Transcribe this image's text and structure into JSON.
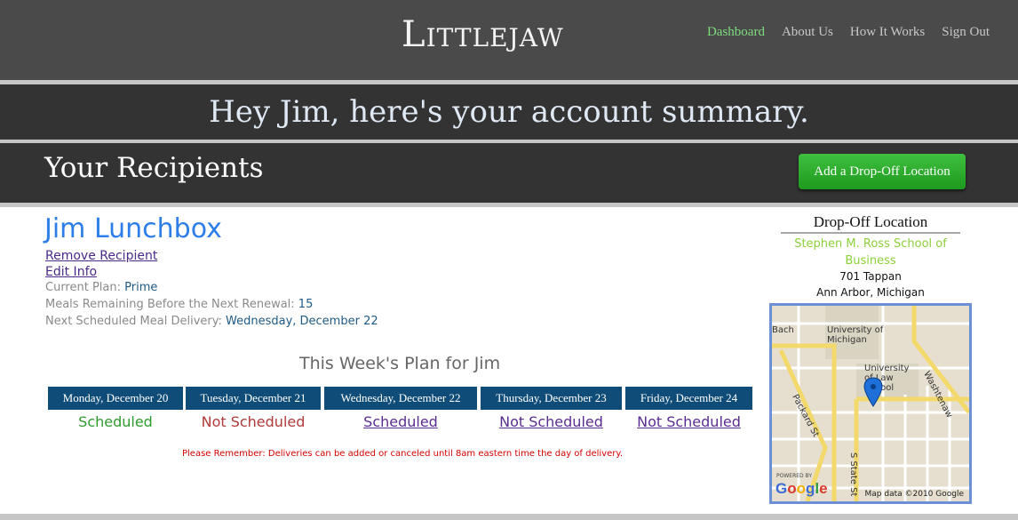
{
  "header": {
    "logo": "Littlejaw",
    "nav": [
      "Dashboard",
      "About Us",
      "How It Works",
      "Sign Out"
    ]
  },
  "summary_title": "Hey Jim, here's your account summary.",
  "recipients": {
    "title": "Your Recipients",
    "add_button": "Add a Drop-Off Location"
  },
  "recipient": {
    "name": "Jim Lunchbox",
    "remove_link": "Remove Recipient",
    "edit_link": "Edit Info",
    "plan_label": "Current Plan:",
    "plan_value": "Prime",
    "meals_label": "Meals Remaining Before the Next Renewal:",
    "meals_value": "15",
    "next_label": "Next Scheduled Meal Delivery:",
    "next_value": "Wednesday, December 22"
  },
  "week": {
    "title": "This Week's Plan for Jim",
    "days": [
      {
        "day": "Monday, December 20",
        "status": "Scheduled"
      },
      {
        "day": "Tuesday, December 21",
        "status": "Not Scheduled"
      },
      {
        "day": "Wednesday, December 22",
        "status": "Scheduled"
      },
      {
        "day": "Thursday, December 23",
        "status": "Not Scheduled"
      },
      {
        "day": "Friday, December 24",
        "status": "Not Scheduled"
      }
    ],
    "reminder": "Please Remember: Deliveries can be added or canceled until 8am eastern time the day of delivery."
  },
  "dropoff": {
    "title": "Drop-Off Location",
    "place": "Stephen M. Ross School of Business",
    "street": "701 Tappan",
    "city": "Ann Arbor, Michigan",
    "map_labels": {
      "university": "University of Michigan",
      "law": "University of Law School",
      "packard": "Packard St",
      "state": "S State St",
      "washtenaw": "Washtenaw",
      "bach": "Bach"
    },
    "map_footer": "Map data ©2010 Google",
    "powered": "POWERED BY",
    "google": "Google"
  },
  "colors": {
    "nav_active": "#7ddc7d",
    "add_button": "#2aa52a",
    "recipient_name": "#2d7ee8",
    "day_header": "#0f4d78",
    "scheduled": "#2e9b2e",
    "not_scheduled": "#b13a3a",
    "reminder": "#d40000"
  }
}
